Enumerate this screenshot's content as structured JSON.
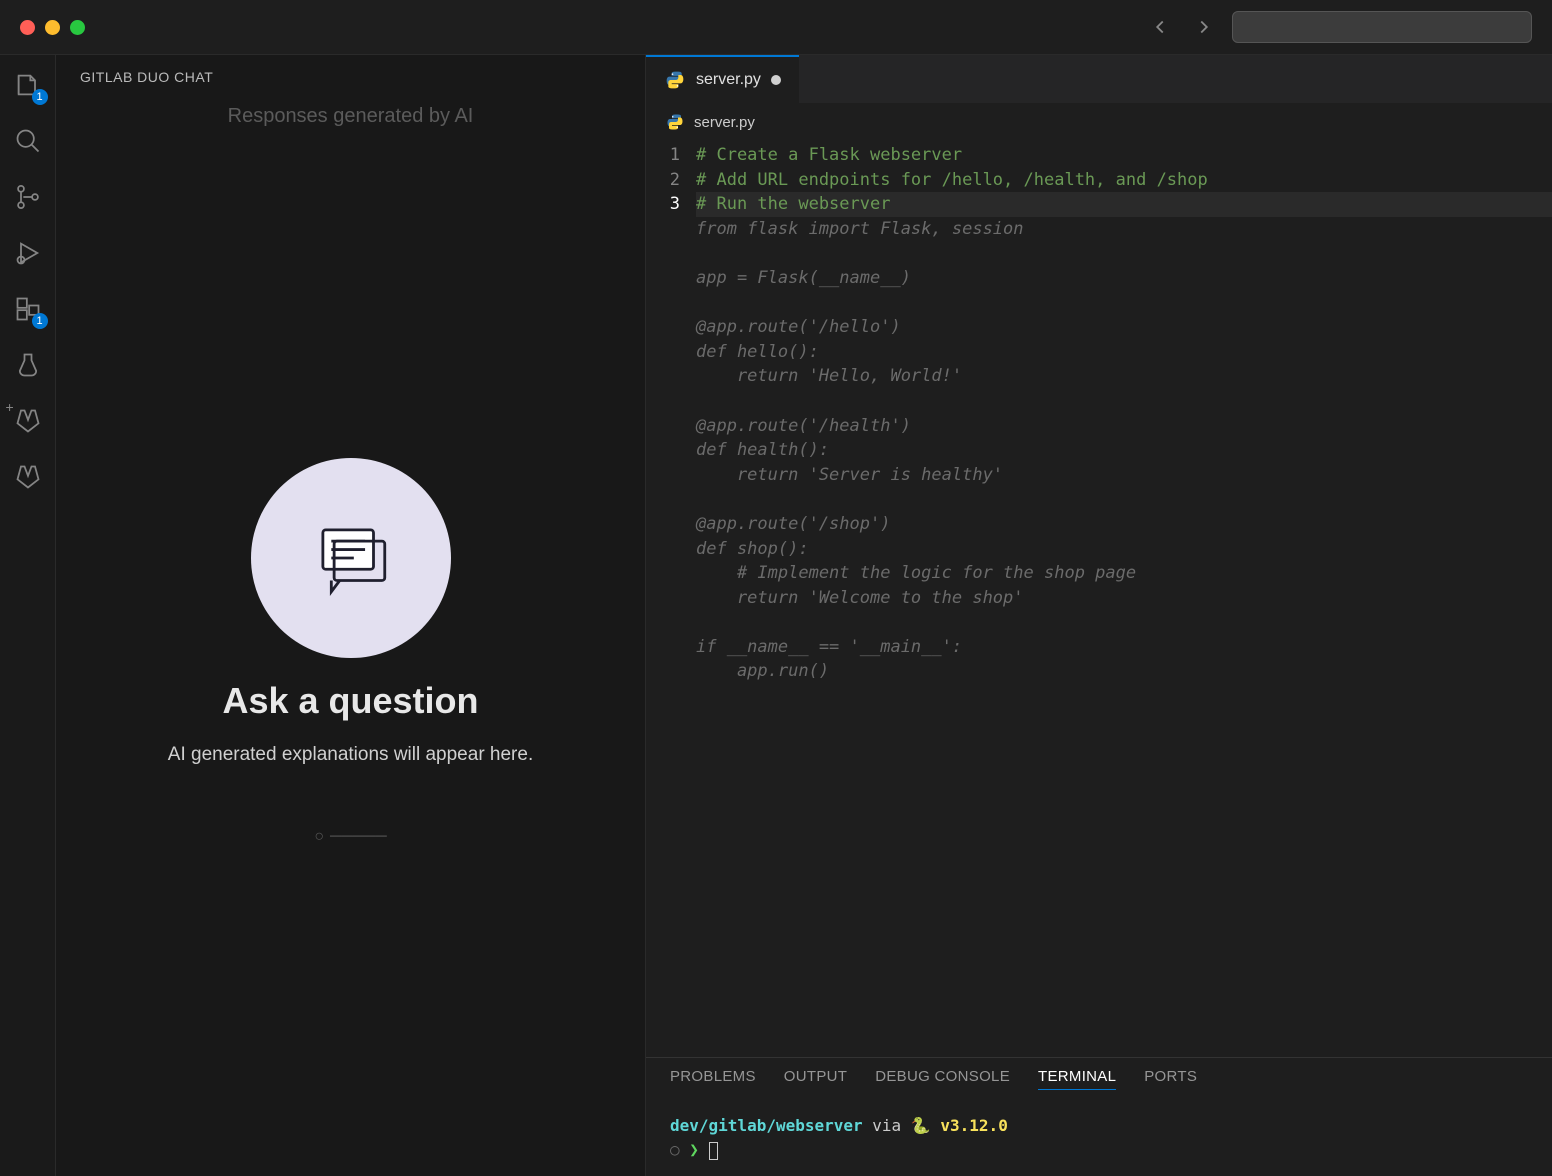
{
  "activityBadges": {
    "explorer": "1",
    "extensions": "1"
  },
  "sidepanel": {
    "title": "GITLAB DUO CHAT",
    "subtitle": "Responses generated by AI",
    "emptyHeading": "Ask a question",
    "emptyDesc": "AI generated explanations will appear here."
  },
  "tab": {
    "label": "server.py"
  },
  "breadcrumb": {
    "file": "server.py"
  },
  "gutter": [
    "1",
    "2",
    "3"
  ],
  "code": {
    "lines": [
      {
        "cls": "c-comment",
        "text": "# Create a Flask webserver"
      },
      {
        "cls": "c-comment",
        "text": "# Add URL endpoints for /hello, /health, and /shop"
      },
      {
        "cls": "c-comment current",
        "text": "# Run the webserver"
      },
      {
        "cls": "c-ghost",
        "text": "from flask import Flask, session"
      },
      {
        "cls": "c-ghost",
        "text": ""
      },
      {
        "cls": "c-ghost",
        "text": "app = Flask(__name__)"
      },
      {
        "cls": "c-ghost",
        "text": ""
      },
      {
        "cls": "c-ghost",
        "text": "@app.route('/hello')"
      },
      {
        "cls": "c-ghost",
        "text": "def hello():"
      },
      {
        "cls": "c-ghost",
        "text": "    return 'Hello, World!'"
      },
      {
        "cls": "c-ghost",
        "text": ""
      },
      {
        "cls": "c-ghost",
        "text": "@app.route('/health')"
      },
      {
        "cls": "c-ghost",
        "text": "def health():"
      },
      {
        "cls": "c-ghost",
        "text": "    return 'Server is healthy'"
      },
      {
        "cls": "c-ghost",
        "text": ""
      },
      {
        "cls": "c-ghost",
        "text": "@app.route('/shop')"
      },
      {
        "cls": "c-ghost",
        "text": "def shop():"
      },
      {
        "cls": "c-ghost",
        "text": "    # Implement the logic for the shop page"
      },
      {
        "cls": "c-ghost",
        "text": "    return 'Welcome to the shop'"
      },
      {
        "cls": "c-ghost",
        "text": ""
      },
      {
        "cls": "c-ghost",
        "text": "if __name__ == '__main__':"
      },
      {
        "cls": "c-ghost",
        "text": "    app.run()"
      }
    ]
  },
  "panelTabs": {
    "problems": "PROBLEMS",
    "output": "OUTPUT",
    "debug": "DEBUG CONSOLE",
    "terminal": "TERMINAL",
    "ports": "PORTS"
  },
  "terminal": {
    "path": "dev/gitlab/webserver",
    "via": " via ",
    "snake": "🐍 ",
    "version": "v3.12.0",
    "promptCircle": "○",
    "promptArrow": "❯"
  }
}
